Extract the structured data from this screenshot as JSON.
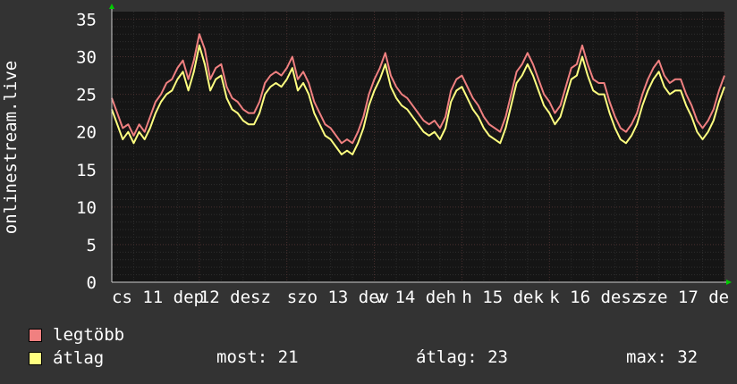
{
  "chart_data": {
    "type": "line",
    "ylabel": "onlinestream.live",
    "ylim": [
      0,
      36
    ],
    "yticks": [
      0,
      5,
      10,
      15,
      20,
      25,
      30,
      35
    ],
    "xticks": [
      "cs 11 dep",
      "12 desz",
      "szo 13 dev",
      "v 14 deh",
      "h 15 dek",
      "k 16 desz",
      "sze 17 de"
    ],
    "grid": true,
    "series": [
      {
        "name": "legtöbb",
        "color": "#f08080",
        "values": [
          24.5,
          22.5,
          20.5,
          21,
          19.5,
          21,
          20,
          22,
          24,
          25,
          26.5,
          27,
          28.5,
          29.5,
          27,
          29.5,
          33,
          31,
          27,
          28.5,
          29,
          26,
          24.5,
          24,
          23,
          22.5,
          22.5,
          24,
          26.5,
          27.5,
          28,
          27.5,
          28.5,
          30,
          27,
          28,
          26.5,
          24,
          22.5,
          21,
          20.5,
          19.5,
          18.5,
          19,
          18.5,
          20,
          22,
          25,
          27,
          28.5,
          30.5,
          27.5,
          26,
          25,
          24.5,
          23.5,
          22.5,
          21.5,
          21,
          21.5,
          20.5,
          22,
          25.5,
          27,
          27.5,
          26,
          24.5,
          23.5,
          22,
          21,
          20.5,
          20,
          22,
          25,
          28,
          29,
          30.5,
          29,
          27,
          25,
          24,
          22.5,
          23.5,
          26,
          28.5,
          29,
          31.5,
          29,
          27,
          26.5,
          26.5,
          24,
          22,
          20.5,
          20,
          21,
          22.5,
          25,
          27,
          28.5,
          29.5,
          27.5,
          26.5,
          27,
          27,
          25,
          23.5,
          21.5,
          20.5,
          21.5,
          23,
          25.5,
          27.5
        ]
      },
      {
        "name": "átlag",
        "color": "#ffff80",
        "values": [
          23,
          21,
          19,
          20,
          18.5,
          20,
          19,
          20.5,
          22.5,
          24,
          25,
          25.5,
          27,
          28,
          25.5,
          28,
          31.5,
          29,
          25.5,
          27,
          27.5,
          24.5,
          23,
          22.5,
          21.5,
          21,
          21,
          22.5,
          25,
          26,
          26.5,
          26,
          27,
          28.5,
          25.5,
          26.5,
          25,
          22.5,
          21,
          19.5,
          19,
          18,
          17,
          17.5,
          17,
          18.5,
          20.5,
          23.5,
          25.5,
          27,
          29,
          26,
          24.5,
          23.5,
          23,
          22,
          21,
          20,
          19.5,
          20,
          19,
          20.5,
          24,
          25.5,
          26,
          24.5,
          23,
          22,
          20.5,
          19.5,
          19,
          18.5,
          20.5,
          23.5,
          26.5,
          27.5,
          29,
          27.5,
          25.5,
          23.5,
          22.5,
          21,
          22,
          24.5,
          27,
          27.5,
          30,
          27.5,
          25.5,
          25,
          25,
          22.5,
          20.5,
          19,
          18.5,
          19.5,
          21,
          23.5,
          25.5,
          27,
          28,
          26,
          25,
          25.5,
          25.5,
          23.5,
          22,
          20,
          19,
          20,
          21.5,
          24,
          26
        ]
      }
    ]
  },
  "legend": {
    "max_label": "legtöbb",
    "avg_label": "átlag"
  },
  "stats": {
    "now": "most: 21",
    "avg": "átlag: 23",
    "max": "max: 32"
  }
}
